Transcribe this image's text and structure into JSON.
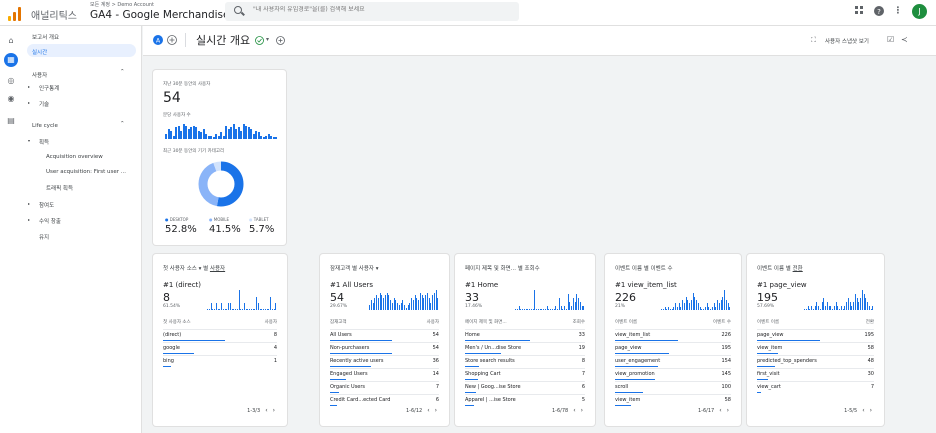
{
  "topbar": {
    "brand": "애널리틱스",
    "account_path": "모든 계정 > Demo Account",
    "property": "GA4 - Google Merchandise ...",
    "search_placeholder": "\"내 사용자의 유입경로\"을(를) 검색해 보세요",
    "avatar_letter": "J"
  },
  "rail": {
    "icons": [
      "home-icon",
      "reports-icon",
      "explore-icon",
      "advertising-icon",
      "configure-icon"
    ]
  },
  "nav": {
    "reports_overview": "보고서 개요",
    "realtime": "실시간",
    "user_section": "사용자",
    "demographics": "인구통계",
    "tech": "기술",
    "lifecycle": "Life cycle",
    "acquisition": "획득",
    "acq_overview": "Acquisition overview",
    "user_acq": "User acquisition: First user ...",
    "traffic_acq": "트래픽 획득",
    "engagement": "참여도",
    "monetization": "수익 창출",
    "retention": "유지"
  },
  "header": {
    "title": "실시간 개요",
    "snapshot": "사용자 스냅샷 보기"
  },
  "overview_card": {
    "users_label": "지난 30분 동안의 사용자",
    "users_value": "54",
    "per_minute_label": "분당 사용자 수",
    "device_label": "최근 30분 동안의 기기 카테고리",
    "devices": [
      {
        "name": "DESKTOP",
        "pct": "52.8%",
        "color": "#1a73e8",
        "value": 52.8
      },
      {
        "name": "MOBILE",
        "pct": "41.5%",
        "color": "#8ab4f8",
        "value": 41.5
      },
      {
        "name": "TABLET",
        "pct": "5.7%",
        "color": "#d2e3fc",
        "value": 5.7
      }
    ],
    "spark": [
      3,
      6,
      5,
      2,
      7,
      8,
      5,
      9,
      8,
      6,
      7,
      8,
      7,
      5,
      4,
      6,
      3,
      2,
      2,
      1,
      3,
      2,
      4,
      2,
      8,
      6,
      7,
      9,
      6,
      7,
      5,
      9,
      8,
      7,
      6,
      3,
      5,
      4,
      2,
      1,
      2,
      3,
      2,
      1,
      1
    ]
  },
  "cards": [
    {
      "title_pre": "첫 사용자 소스 ▾ 별 ",
      "title_link": "사용자",
      "top": "#1 (direct)",
      "value": "8",
      "pct": "61.54%",
      "col1": "첫 사용자 소스",
      "col2": "사용자",
      "rows": [
        {
          "name": "(direct)",
          "value": "8",
          "frac": 0.9
        },
        {
          "name": "google",
          "value": "4",
          "frac": 0.45
        },
        {
          "name": "bing",
          "value": "1",
          "frac": 0.12
        }
      ],
      "pager": "1-3/3",
      "spark": [
        0,
        0,
        1,
        0,
        0,
        1,
        0,
        0,
        1,
        0,
        0,
        0,
        1,
        1,
        0,
        0,
        0,
        0,
        3,
        0,
        0,
        1,
        0,
        0,
        0,
        0,
        0,
        0,
        2,
        1,
        0,
        0,
        0,
        0,
        0,
        0,
        2,
        0,
        0,
        1
      ]
    },
    {
      "title_pre": "잠재고객 별 사용자 ▾",
      "title_link": "",
      "top": "#1 All Users",
      "value": "54",
      "pct": "29.67%",
      "col1": "잠재고객",
      "col2": "사용자",
      "rows": [
        {
          "name": "All Users",
          "value": "54",
          "frac": 0.95
        },
        {
          "name": "Non-purchasers",
          "value": "54",
          "frac": 0.95
        },
        {
          "name": "Recently active users",
          "value": "36",
          "frac": 0.62
        },
        {
          "name": "Engaged Users",
          "value": "14",
          "frac": 0.25
        },
        {
          "name": "Organic Users",
          "value": "7",
          "frac": 0.13
        },
        {
          "name": "Credit Card...ected Card",
          "value": "6",
          "frac": 0.1
        }
      ],
      "pager": "1-6/12",
      "spark": [
        2,
        4,
        3,
        5,
        6,
        5,
        7,
        6,
        5,
        6,
        7,
        6,
        4,
        3,
        5,
        4,
        3,
        2,
        3,
        4,
        2,
        1,
        2,
        3,
        5,
        4,
        6,
        5,
        4,
        7,
        6,
        5,
        6,
        7,
        5,
        3,
        6,
        7,
        8,
        5
      ]
    },
    {
      "title_pre": "페이지 제목 및 화면... 별 조회수",
      "title_link": "",
      "top": "#1 Home",
      "value": "33",
      "pct": "17.46%",
      "col1": "페이지 제목 및 화면...",
      "col2": "조회수",
      "rows": [
        {
          "name": "Home",
          "value": "33",
          "frac": 0.9
        },
        {
          "name": "Men's / Un...dise Store",
          "value": "19",
          "frac": 0.5
        },
        {
          "name": "Store search results",
          "value": "8",
          "frac": 0.2
        },
        {
          "name": "Shopping Cart",
          "value": "7",
          "frac": 0.18
        },
        {
          "name": "New | Goog...ise Store",
          "value": "6",
          "frac": 0.15
        },
        {
          "name": "Apparel | ...ise Store",
          "value": "5",
          "frac": 0.13
        }
      ],
      "pager": "1-6/78",
      "spark": [
        0,
        0,
        1,
        0,
        0,
        0,
        0,
        0,
        0,
        0,
        0,
        5,
        0,
        0,
        0,
        0,
        0,
        0,
        1,
        0,
        0,
        0,
        0,
        1,
        0,
        3,
        1,
        0,
        1,
        0,
        4,
        2,
        1,
        3,
        2,
        4,
        3,
        2,
        1,
        1
      ]
    },
    {
      "title_pre": "이벤트 이름 별 이벤트 수",
      "title_link": "",
      "top": "#1 view_item_list",
      "value": "226",
      "pct": "21%",
      "col1": "이벤트 이름",
      "col2": "이벤트 수",
      "rows": [
        {
          "name": "view_item_list",
          "value": "226",
          "frac": 0.9
        },
        {
          "name": "page_view",
          "value": "195",
          "frac": 0.78
        },
        {
          "name": "user_engagement",
          "value": "154",
          "frac": 0.62
        },
        {
          "name": "view_promotion",
          "value": "145",
          "frac": 0.58
        },
        {
          "name": "scroll",
          "value": "100",
          "frac": 0.4
        },
        {
          "name": "view_item",
          "value": "58",
          "frac": 0.23
        }
      ],
      "pager": "1-6/17",
      "spark": [
        0,
        0,
        1,
        0,
        1,
        0,
        0,
        1,
        2,
        1,
        2,
        1,
        3,
        2,
        4,
        3,
        2,
        3,
        5,
        4,
        3,
        2,
        1,
        0,
        0,
        1,
        2,
        1,
        0,
        1,
        2,
        1,
        3,
        2,
        3,
        4,
        6,
        3,
        2,
        1
      ]
    },
    {
      "title_pre": "이벤트 이름 별 ",
      "title_link": "전환",
      "top": "#1 page_view",
      "value": "195",
      "pct": "57.69%",
      "col1": "이벤트 이름",
      "col2": "전환",
      "rows": [
        {
          "name": "page_view",
          "value": "195",
          "frac": 0.9
        },
        {
          "name": "view_item",
          "value": "58",
          "frac": 0.3
        },
        {
          "name": "predicted_top_spenders",
          "value": "48",
          "frac": 0.25
        },
        {
          "name": "first_visit",
          "value": "30",
          "frac": 0.16
        },
        {
          "name": "view_cart",
          "value": "7",
          "frac": 0.05
        }
      ],
      "pager": "1-5/5",
      "spark": [
        0,
        0,
        1,
        0,
        1,
        0,
        1,
        2,
        1,
        0,
        2,
        3,
        1,
        2,
        1,
        1,
        0,
        1,
        2,
        1,
        0,
        1,
        0,
        1,
        2,
        3,
        2,
        1,
        2,
        4,
        3,
        2,
        3,
        5,
        4,
        3,
        2,
        1,
        0,
        1
      ]
    }
  ]
}
